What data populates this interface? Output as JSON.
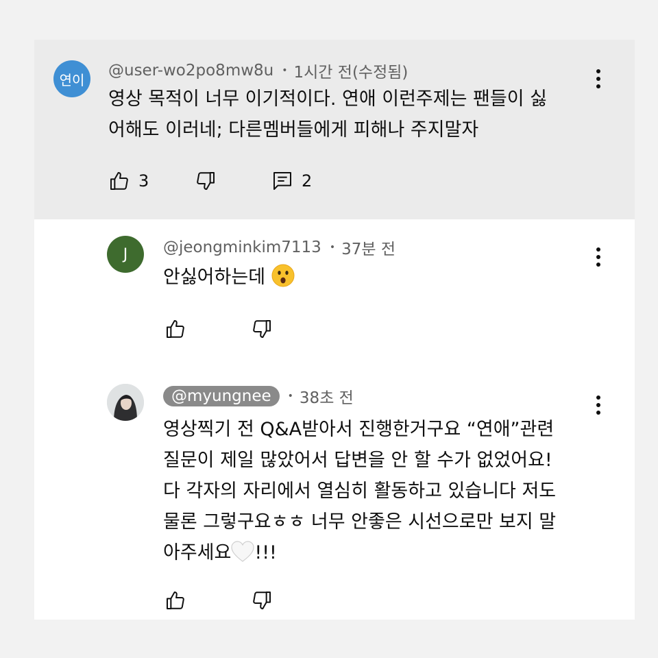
{
  "main_comment": {
    "avatar_text": "연이",
    "avatar_color": "#3f8fd4",
    "handle": "@user-wo2po8mw8u",
    "time": "1시간 전(수정됨)",
    "text_line1": "영상 목적이 너무 이기적이다. 연애 이런주제는 팬들이 싫",
    "text_line2": "어해도 이러네; 다른멤버들에게 피해나 주지말자",
    "like_count": "3",
    "reply_count": "2"
  },
  "replies": [
    {
      "avatar_text": "J",
      "avatar_color": "#3e6b2e",
      "handle": "@jeongminkim7113",
      "time": "37분 전",
      "text": "안싫어하는데",
      "emoji": "surprised-face"
    },
    {
      "handle": "@myungnee",
      "time": "38초 전",
      "line1": "영상찍기 전 Q&A받아서 진행한거구요 “연애”관련",
      "line2": "질문이 제일 많았어서 답변을 안 할 수가 없었어요!",
      "line3": "다 각자의 자리에서 열심히 활동하고 있습니다 저도",
      "line4": "물론 그렇구요ㅎㅎ 너무 안좋은 시선으로만 보지 말",
      "line5_text": "아주세요",
      "line5_suffix": "!!!",
      "emoji": "white-heart"
    }
  ],
  "icons": {
    "like": "thumbs-up-icon",
    "dislike": "thumbs-down-icon",
    "reply": "comment-icon",
    "more": "kebab-menu-icon"
  }
}
